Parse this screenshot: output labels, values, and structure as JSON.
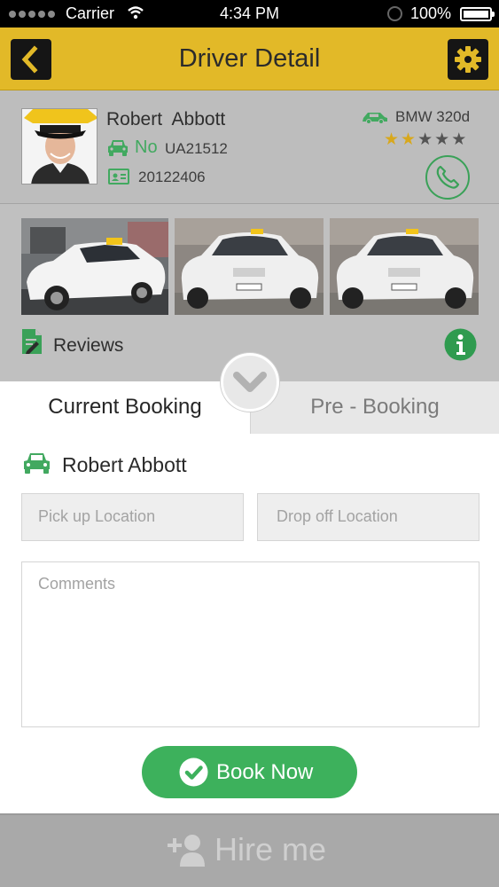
{
  "status_bar": {
    "carrier": "Carrier",
    "time": "4:34 PM",
    "battery": "100%"
  },
  "header": {
    "title": "Driver Detail",
    "back_icon": "chevron-left-icon",
    "settings_icon": "gear-icon"
  },
  "driver": {
    "name": "Robert  Abbott",
    "available_label": "No",
    "plate": "UA21512",
    "license_number": "20122406",
    "car_model": "BMW 320d",
    "rating": {
      "filled": 2,
      "total": 5
    }
  },
  "reviews": {
    "label": "Reviews"
  },
  "tabs": {
    "current": "Current Booking",
    "pre": "Pre - Booking"
  },
  "booking": {
    "customer_name": "Robert Abbott",
    "pickup_placeholder": "Pick up Location",
    "dropoff_placeholder": "Drop off Location",
    "comments_placeholder": "Comments",
    "book_label": "Book Now"
  },
  "hire": {
    "label": "Hire me"
  },
  "colors": {
    "accent": "#e2b928",
    "green": "#3db15c",
    "dark": "#151515"
  }
}
